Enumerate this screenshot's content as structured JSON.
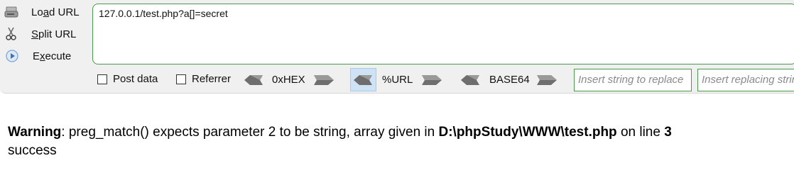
{
  "sidebar": {
    "load_url": {
      "prefix": "Lo",
      "ul": "a",
      "suffix": "d URL"
    },
    "split_url": {
      "prefix": "",
      "ul": "S",
      "suffix": "plit URL"
    },
    "execute": {
      "prefix": "E",
      "ul": "x",
      "suffix": "ecute"
    }
  },
  "url_field": {
    "value": "127.0.0.1/test.php?a[]=secret"
  },
  "options": {
    "post_data": "Post data",
    "referrer": "Referrer"
  },
  "encoders": {
    "hex": "0xHEX",
    "url": "%URL",
    "base64": "BASE64"
  },
  "replace": {
    "find_placeholder": "Insert string to replace",
    "replace_placeholder": "Insert replacing string"
  },
  "output": {
    "warning_label": "Warning",
    "warning_msg": ": preg_match() expects parameter 2 to be string, array given in ",
    "path": "D:\\phpStudy\\WWW\\test.php",
    "on_line": " on line ",
    "line_no": "3",
    "result": "success"
  },
  "colors": {
    "accent_border": "#4a9a4a",
    "active_encoder": "#cfe3f7"
  }
}
